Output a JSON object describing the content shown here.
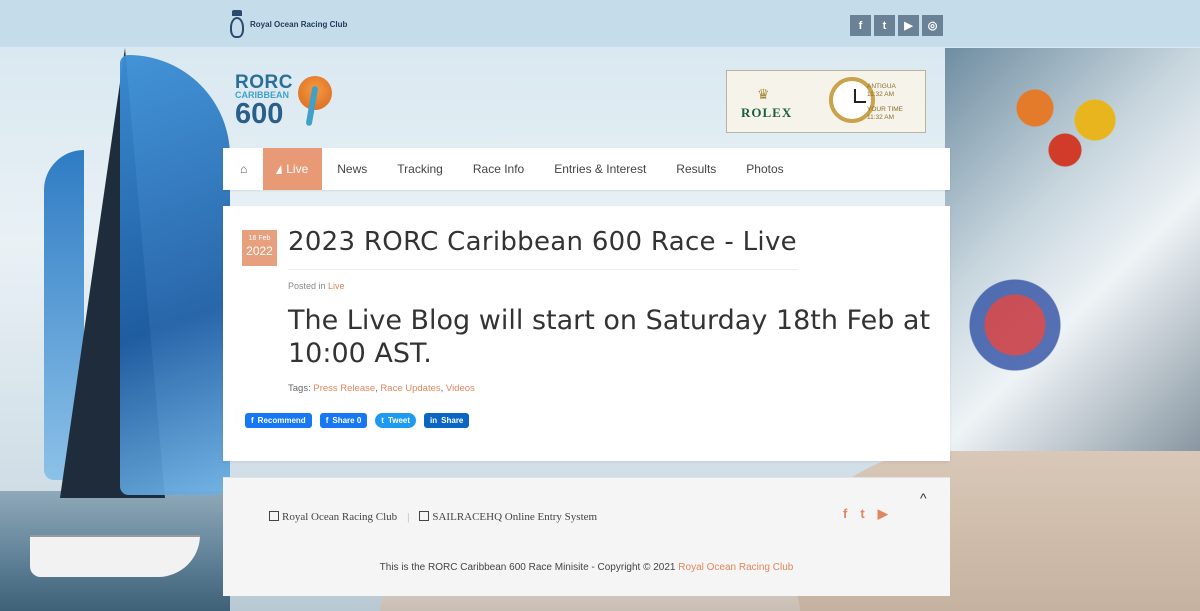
{
  "header": {
    "org_name": "Royal Ocean Racing Club",
    "social": [
      {
        "icon": "facebook-icon",
        "glyph": "f"
      },
      {
        "icon": "twitter-icon",
        "glyph": "t"
      },
      {
        "icon": "youtube-icon",
        "glyph": "▶"
      },
      {
        "icon": "instagram-icon",
        "glyph": "◎"
      }
    ]
  },
  "logo": {
    "line1": "RORC",
    "line2": "CARIBBEAN",
    "line3": "600"
  },
  "sponsor": {
    "brand": "ROLEX",
    "location1": "ANTIGUA",
    "time1": "11:32 AM",
    "location2": "YOUR TIME",
    "time2": "11:32 AM"
  },
  "nav": {
    "items": [
      "Live",
      "News",
      "Tracking",
      "Race Info",
      "Entries & Interest",
      "Results",
      "Photos"
    ],
    "active": "Live"
  },
  "article": {
    "date_day": "16 Feb",
    "date_year": "2022",
    "title": "2023 RORC Caribbean 600 Race - Live",
    "posted_prefix": "Posted in",
    "posted_category": "Live",
    "lead": "The Live Blog will start on Saturday 18th Feb at 10:00 AST.",
    "tags_label": "Tags:",
    "tags": [
      "Press Release",
      "Race Updates",
      "Videos"
    ],
    "share": {
      "recommend": "Recommend",
      "share_fb": "Share",
      "share_count": "0",
      "tweet": "Tweet",
      "share_li": "Share"
    }
  },
  "footer": {
    "link1": "Royal Ocean Racing Club",
    "link2": "SAILRACEHQ Online Entry System",
    "copyright_text": "This is the RORC Caribbean 600 Race Minisite - Copyright © 2021",
    "copyright_link": "Royal Ocean Racing Club"
  },
  "colors": {
    "accent": "#e89a77",
    "link": "#e0875f",
    "topbar": "#c5dcea"
  }
}
